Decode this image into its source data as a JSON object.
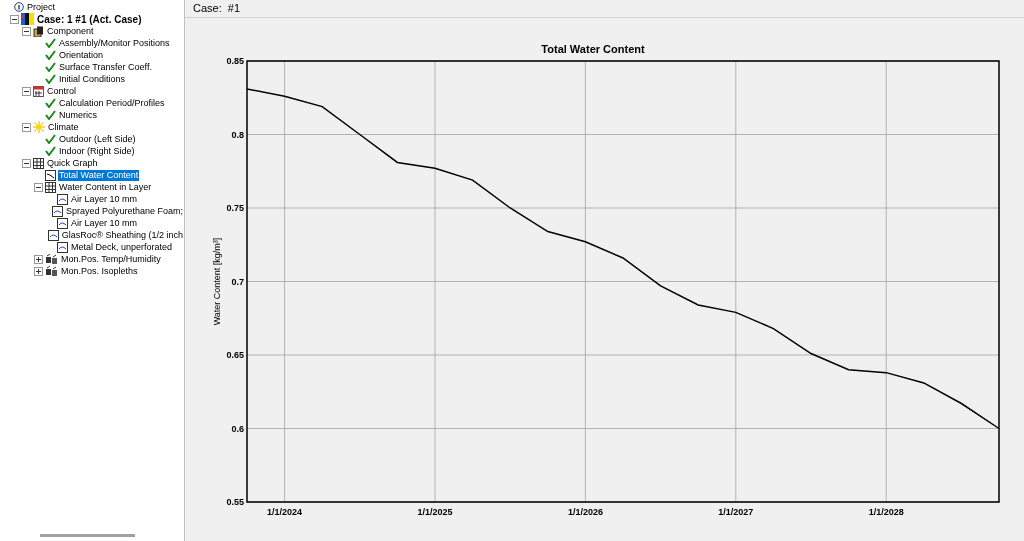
{
  "tree": [
    {
      "label": "Project",
      "kind": "project",
      "selected": false,
      "children": [
        {
          "label": "Case: 1 #1 (Act. Case)",
          "kind": "case",
          "selected": false,
          "expanded": true,
          "children": [
            {
              "label": "Component",
              "kind": "component",
              "selected": false,
              "expanded": true,
              "children": [
                {
                  "label": "Assembly/Monitor Positions",
                  "kind": "check",
                  "selected": false
                },
                {
                  "label": "Orientation",
                  "kind": "check",
                  "selected": false
                },
                {
                  "label": "Surface Transfer Coeff.",
                  "kind": "check",
                  "selected": false
                },
                {
                  "label": "Initial Conditions",
                  "kind": "check",
                  "selected": false
                }
              ]
            },
            {
              "label": "Control",
              "kind": "control",
              "selected": false,
              "expanded": true,
              "children": [
                {
                  "label": "Calculation Period/Profiles",
                  "kind": "check",
                  "selected": false
                },
                {
                  "label": "Numerics",
                  "kind": "check",
                  "selected": false
                }
              ]
            },
            {
              "label": "Climate",
              "kind": "climate",
              "selected": false,
              "expanded": true,
              "children": [
                {
                  "label": "Outdoor (Left Side)",
                  "kind": "check",
                  "selected": false
                },
                {
                  "label": "Indoor (Right Side)",
                  "kind": "check",
                  "selected": false
                }
              ]
            },
            {
              "label": "Quick Graph",
              "kind": "grid",
              "selected": false,
              "expanded": true,
              "children": [
                {
                  "label": "Total Water Content",
                  "kind": "graph",
                  "selected": true
                },
                {
                  "label": "Water Content in Layer",
                  "kind": "grid",
                  "selected": false,
                  "expanded": true,
                  "children": [
                    {
                      "label": "Air Layer 10 mm",
                      "kind": "layer",
                      "selected": false
                    },
                    {
                      "label": "Sprayed Polyurethane Foam;",
                      "kind": "layer",
                      "selected": false
                    },
                    {
                      "label": "Air Layer 10 mm",
                      "kind": "layer",
                      "selected": false
                    },
                    {
                      "label": "GlasRoc® Sheathing (1/2 inch",
                      "kind": "layer",
                      "selected": false
                    },
                    {
                      "label": "Metal Deck, unperforated",
                      "kind": "layer",
                      "selected": false
                    }
                  ]
                },
                {
                  "label": "Mon.Pos. Temp/Humidity",
                  "kind": "monitor",
                  "selected": false,
                  "expanded": false
                },
                {
                  "label": "Mon.Pos. Isopleths",
                  "kind": "monitor",
                  "selected": false,
                  "expanded": false
                }
              ]
            }
          ]
        }
      ]
    }
  ],
  "case_label": "Case:  #1",
  "chart_data": {
    "type": "line",
    "grid": true,
    "title": "Total Water Content",
    "ylabel": "Water Content [kg/m³]",
    "ylim": [
      0.55,
      0.85
    ],
    "yticks": [
      0.55,
      0.6,
      0.65,
      0.7,
      0.75,
      0.8,
      0.85
    ],
    "categories": [
      null,
      "1/1/2024",
      null,
      null,
      null,
      "1/1/2025",
      null,
      null,
      null,
      "1/1/2026",
      null,
      null,
      null,
      "1/1/2027",
      null,
      null,
      null,
      "1/1/2028",
      null,
      null,
      null
    ],
    "series": [
      {
        "color": "#000000",
        "values": [
          0.831,
          0.826,
          0.819,
          0.8,
          0.781,
          0.777,
          0.769,
          0.75,
          0.734,
          0.727,
          0.716,
          0.697,
          0.684,
          0.679,
          0.668,
          0.651,
          0.64,
          0.638,
          0.631,
          0.617,
          0.6
        ]
      }
    ]
  }
}
